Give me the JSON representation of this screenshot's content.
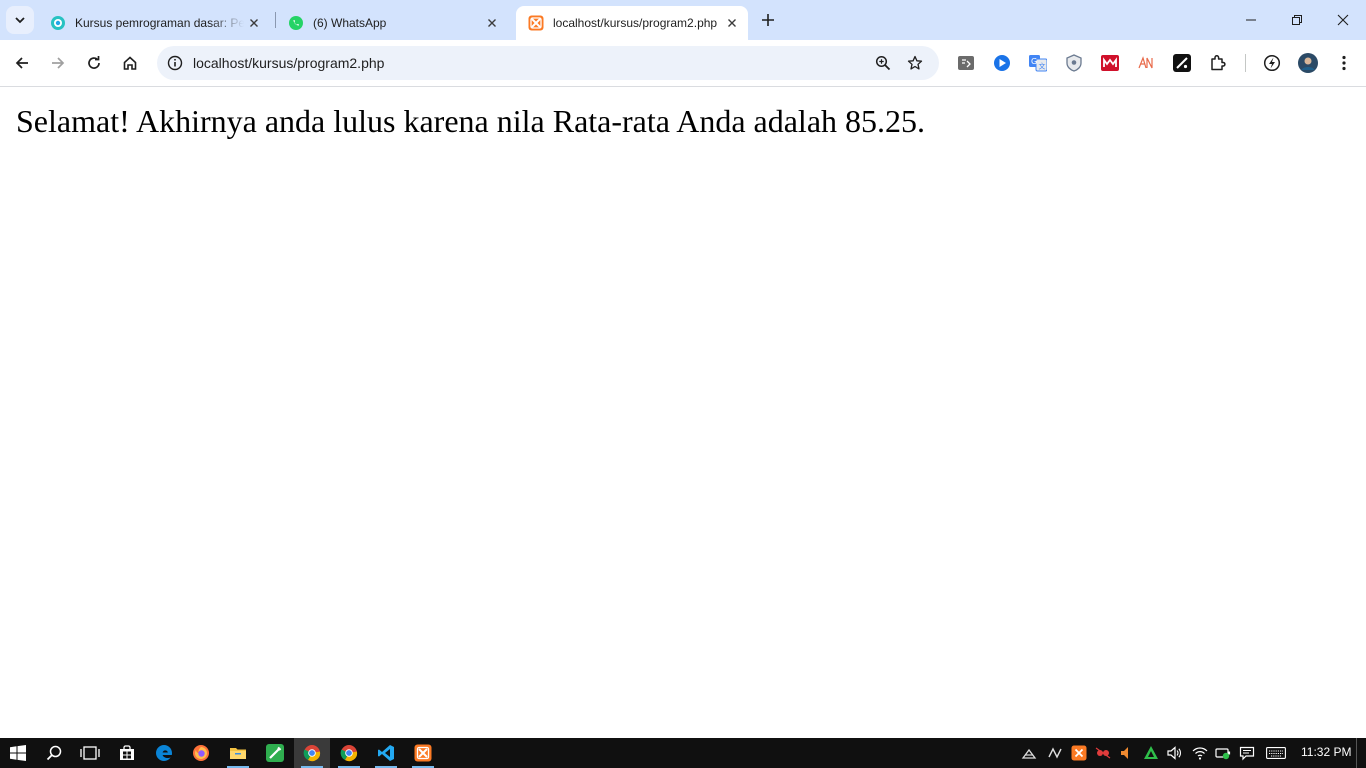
{
  "browser": {
    "tabs": [
      {
        "title": "Kursus pemrograman dasar: Pel",
        "favicon": "course-favicon",
        "active": false
      },
      {
        "title": "(6) WhatsApp",
        "favicon": "whatsapp-icon",
        "active": false
      },
      {
        "title": "localhost/kursus/program2.php",
        "favicon": "xampp-icon",
        "active": true
      }
    ],
    "address_bar": {
      "url": "localhost/kursus/program2.php"
    },
    "nav_icons": [
      "back-icon",
      "forward-icon",
      "reload-icon",
      "home-icon"
    ],
    "extensions": [
      "ext-icon-1",
      "ext-icon-2",
      "translate-icon",
      "shield-icon",
      "ext-icon-red",
      "ext-icon-an",
      "ext-icon-black",
      "puzzle-icon",
      "performance-icon",
      "profile-avatar",
      "menu-icon"
    ]
  },
  "page": {
    "message": "Selamat! Akhirnya anda lulus karena nila Rata-rata Anda adalah 85.25."
  },
  "taskbar": {
    "clock": "11:32 PM",
    "apps": [
      "windows-start-icon",
      "search-icon",
      "task-view-icon",
      "store-icon",
      "edge-icon",
      "firefox-icon",
      "file-explorer-icon",
      "green-app-icon",
      "chrome-icon",
      "chrome-icon",
      "vscode-icon",
      "xampp-icon"
    ]
  },
  "colors": {
    "tabstrip": "#d3e3fd",
    "omnibox": "#edf2fa",
    "taskbar": "#101010"
  }
}
